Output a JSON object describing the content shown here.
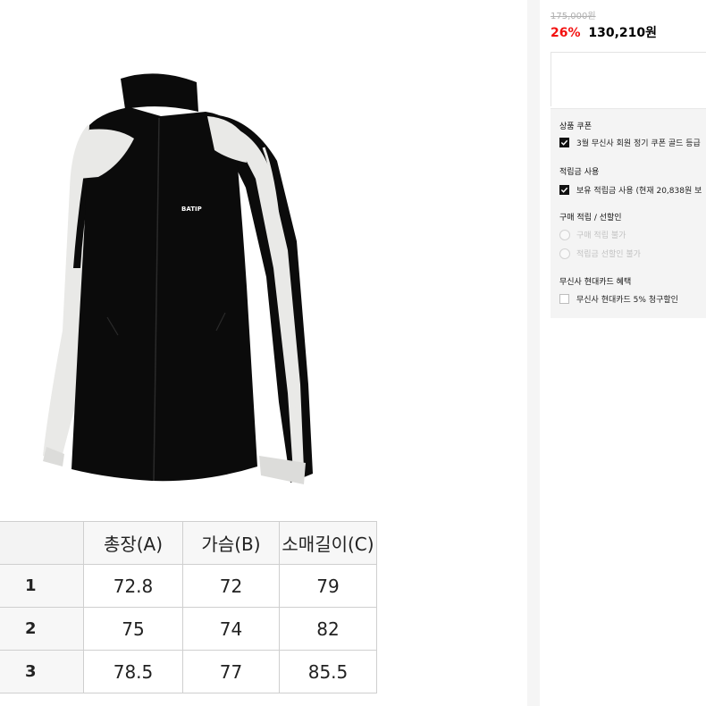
{
  "size_table": {
    "headers": [
      "",
      "총장(A)",
      "가슴(B)",
      "소매길이(C)"
    ],
    "rows": [
      {
        "label": "1",
        "values": [
          "72.8",
          "72",
          "79"
        ]
      },
      {
        "label": "2",
        "values": [
          "75",
          "74",
          "82"
        ]
      },
      {
        "label": "3",
        "values": [
          "78.5",
          "77",
          "85.5"
        ]
      }
    ]
  },
  "product": {
    "image_logo_text": "BATIP",
    "colors": {
      "body": "#0b0b0b",
      "sleeve": "#e9e9e7",
      "accent_price": "#f31110"
    }
  },
  "price": {
    "original": "175,000원",
    "discount_rate": "26%",
    "sale_price": "130,210원"
  },
  "benefits": {
    "coupon": {
      "title": "상품 쿠폰",
      "option_label": "3월 무신사 회원 정기 쿠폰 골드 등급",
      "checked": true
    },
    "points_use": {
      "title": "적립금 사용",
      "option_label": "보유 적립금 사용 (현재 20,838원 보",
      "checked": true
    },
    "purchase": {
      "title": "구매 적립 / 선할인",
      "options": [
        {
          "label": "구매 적립 불가",
          "disabled": true
        },
        {
          "label": "적립금 선할인 불가",
          "disabled": true
        }
      ]
    },
    "card": {
      "title": "무신사 현대카드 혜택",
      "option_label": "무신사 현대카드 5% 청구할인",
      "checked": false
    }
  }
}
